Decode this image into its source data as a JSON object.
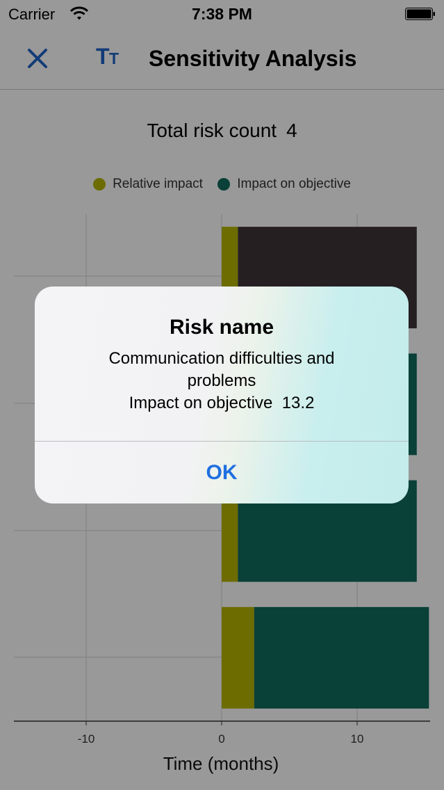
{
  "status_bar": {
    "carrier": "Carrier",
    "time": "7:38 PM"
  },
  "nav": {
    "title": "Sensitivity Analysis",
    "close_icon": "close-icon",
    "text_size_icon": "text-size-icon"
  },
  "summary": {
    "label": "Total risk count",
    "value": "4"
  },
  "legend": [
    {
      "label": "Relative impact",
      "color": "#b4b400"
    },
    {
      "label": "Impact on objective",
      "color": "#0f6b5e"
    }
  ],
  "chart_data": {
    "type": "bar",
    "orientation": "horizontal",
    "stacked": true,
    "xlabel": "Time (months)",
    "xlim": [
      -15,
      15.5
    ],
    "x_ticks": [
      "-10",
      "0",
      "10"
    ],
    "grid": true,
    "categories": [
      "",
      "",
      "",
      ""
    ],
    "series": [
      {
        "name": "Relative impact",
        "color": "#b4b400",
        "values": [
          1.2,
          1.2,
          1.2,
          2.4
        ]
      },
      {
        "name": "Impact on objective",
        "color": "#0f6b5e",
        "values": [
          13.2,
          13.2,
          13.2,
          12.9
        ],
        "highlight_color": "#3f3439",
        "highlight_index": 0
      }
    ]
  },
  "alert": {
    "title": "Risk name",
    "message_line1": "Communication difficulties and",
    "message_line2": "problems",
    "detail_label": "Impact on objective",
    "detail_value": "13.2",
    "ok_label": "OK"
  }
}
